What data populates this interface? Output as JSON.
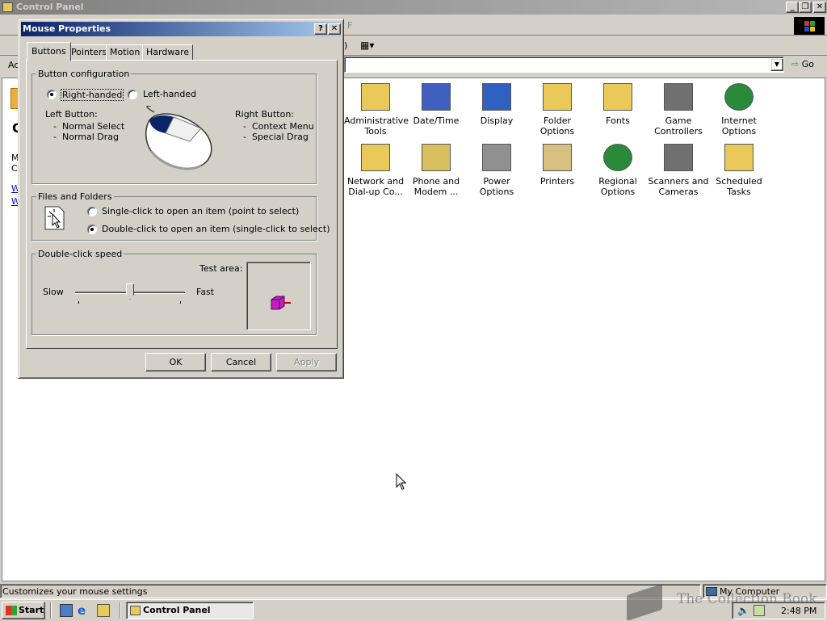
{
  "window": {
    "title": "Control Panel",
    "menu_first_letter": "F",
    "address_label_abbrev": "Ac",
    "go_label": "Go"
  },
  "left_panel": {
    "heading_letter": "C",
    "desc_letters": [
      "M",
      "C"
    ],
    "link_letters": [
      "W",
      "W"
    ]
  },
  "icons": [
    {
      "label": "Administrative Tools",
      "icon": "folder-tools-icon"
    },
    {
      "label": "Date/Time",
      "icon": "calendar-clock-icon"
    },
    {
      "label": "Display",
      "icon": "monitor-icon"
    },
    {
      "label": "Folder Options",
      "icon": "folder-options-icon"
    },
    {
      "label": "Fonts",
      "icon": "fonts-folder-icon"
    },
    {
      "label": "Game Controllers",
      "icon": "joystick-icon"
    },
    {
      "label": "Internet Options",
      "icon": "globe-icon"
    },
    {
      "label": "Network and Dial-up Co...",
      "icon": "network-icon"
    },
    {
      "label": "Phone and Modem ...",
      "icon": "phone-icon"
    },
    {
      "label": "Power Options",
      "icon": "power-plug-icon"
    },
    {
      "label": "Printers",
      "icon": "printer-icon"
    },
    {
      "label": "Regional Options",
      "icon": "globe-regional-icon"
    },
    {
      "label": "Scanners and Cameras",
      "icon": "scanner-icon"
    },
    {
      "label": "Scheduled Tasks",
      "icon": "scheduled-tasks-icon"
    }
  ],
  "dialog": {
    "title": "Mouse Properties",
    "tabs": [
      "Buttons",
      "Pointers",
      "Motion",
      "Hardware"
    ],
    "active_tab": "Buttons",
    "button_config": {
      "group_label": "Button configuration",
      "right_handed": "Right-handed",
      "left_handed": "Left-handed",
      "selected": "Right-handed",
      "left_button_title": "Left Button:",
      "left_button_lines": [
        "-  Normal Select",
        "-  Normal Drag"
      ],
      "right_button_title": "Right Button:",
      "right_button_lines": [
        "-  Context Menu",
        "-  Special Drag"
      ]
    },
    "files_folders": {
      "group_label": "Files and Folders",
      "single_click": "Single-click to open an item (point to select)",
      "double_click": "Double-click to open an item (single-click to select)",
      "selected": "Double-click"
    },
    "double_click_speed": {
      "group_label": "Double-click speed",
      "slow": "Slow",
      "fast": "Fast",
      "test_area": "Test area:",
      "slider_value": 0.5
    },
    "buttons": {
      "ok": "OK",
      "cancel": "Cancel",
      "apply": "Apply"
    }
  },
  "statusbar": {
    "text": "Customizes your mouse settings",
    "zone": "My Computer"
  },
  "taskbar": {
    "start": "Start",
    "task": "Control Panel",
    "clock": "2:48 PM"
  },
  "watermark": "The Collection Book"
}
